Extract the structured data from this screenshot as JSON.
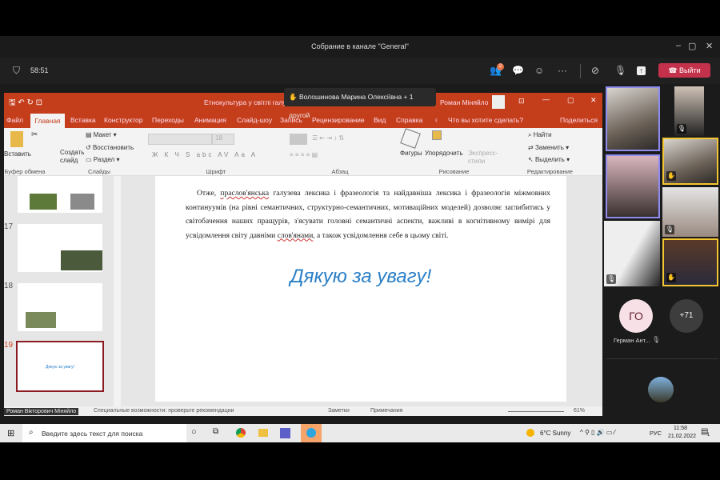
{
  "window": {
    "title": "Собрание в канале \"General\"",
    "min": "–",
    "max": "▢",
    "close": "✕"
  },
  "meeting": {
    "timer": "58:51",
    "participants_badge": "2",
    "leave_label": "Выйти"
  },
  "tooltip": {
    "text": "Волошинова Марина Олексіївна + 1 другой"
  },
  "ppt": {
    "title": "Етнокультура у світлі галуз",
    "user": "Роман Міняйло",
    "share": "Поделиться",
    "tabs": [
      "Файл",
      "Главная",
      "Вставка",
      "Конструктор",
      "Переходы",
      "Анимация",
      "Слайд-шоу",
      "Запись",
      "Рецензирование",
      "Вид",
      "Справка"
    ],
    "tell_me": "Что вы хотите сделать?",
    "ribbon": {
      "paste": "Вставить",
      "new_slide": "Создать слайд",
      "layout": "Макет",
      "reset": "Восстановить",
      "section": "Раздел",
      "font_size": "18",
      "shapes": "Фигуры",
      "arrange": "Упорядочить",
      "quick_styles": "Экспресс-стили",
      "find": "Найти",
      "replace": "Заменить",
      "select": "Выделить",
      "groups": [
        "Буфер обмена",
        "Слайды",
        "Шрифт",
        "Абзац",
        "Рисование",
        "Редактирование"
      ]
    },
    "thumb_numbers": [
      "17",
      "18",
      "19"
    ],
    "slide": {
      "p1": "Отже, ",
      "u1": "праслов'янська",
      "p2": " галузева лексика і фразеологія та найдавніша лексика і фразеологія міжмовних континуумів (на рівні семантичних, структурно-семантичних, мотиваційних моделей) дозволяє заглибитись у світобачення наших пращурів, з'ясувати головні семантичні аспекти, важливі в когнітивному вимірі для усвідомлення світу давніми ",
      "u2": "слов'янами",
      "p3": ", а також усвідомлення себе в цьому світі.",
      "thanks": "Дякую за увагу!"
    },
    "status": {
      "presenter": "Роман Вікторович Міняйло",
      "accessibility": "Специальные возможности: проверьте рекомендации",
      "notes": "Заметки",
      "comments": "Примечания",
      "zoom": "61%"
    }
  },
  "participants": {
    "initials": "ГО",
    "name": "Герман Ант...",
    "more": "+71"
  },
  "taskbar": {
    "search_placeholder": "Введите здесь текст для поиска",
    "weather": "6°C  Sunny",
    "lang": "РУС",
    "time": "11:58",
    "date": "21.02.2022",
    "notif": "1"
  }
}
